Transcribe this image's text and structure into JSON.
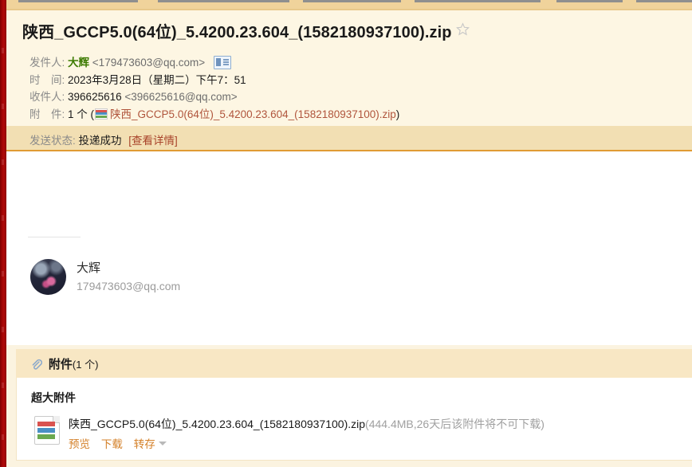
{
  "window": {
    "accent_rail_color": "#a30505",
    "header_bg": "#fdf6e3",
    "status_bg": "#f2dfb3",
    "attachment_bg": "#f8e7c4"
  },
  "tabstrip": {
    "segments": 6
  },
  "header": {
    "subject": "陕西_GCCP5.0(64位)_5.4200.23.604_(1582180937100).zip",
    "star_icon": "star-outline-icon",
    "fields": {
      "from_label": "发件人:",
      "from_name": "大辉",
      "from_email": "<179473603@qq.com>",
      "contact_icon": "contact-card-icon",
      "time_label": "时　间:",
      "time_value": "2023年3月28日（星期二）下午7：51",
      "to_label": "收件人:",
      "to_name": "396625616",
      "to_email": "<396625616@qq.com>",
      "attach_label": "附　件:",
      "attach_count": "1 个 (",
      "attach_icon": "zip-file-icon",
      "attach_name": "陕西_GCCP5.0(64位)_5.4200.23.604_(1582180937100).zip",
      "attach_close": ")"
    }
  },
  "status": {
    "label": "发送状态:",
    "value": "投递成功",
    "link": "[查看详情]"
  },
  "body": {
    "signature": {
      "avatar": "user-avatar",
      "name": "大辉",
      "email": "179473603@qq.com"
    }
  },
  "attachments": {
    "panel_title": "附件",
    "panel_count": "(1 个)",
    "clip_icon": "paperclip-icon",
    "group_title": "超大附件",
    "items": [
      {
        "icon": "zip-file-icon",
        "name": "陕西_GCCP5.0(64位)_5.4200.23.604_(1582180937100).zip",
        "meta": "(444.4MB,26天后该附件将不可下载)",
        "actions": [
          "预览",
          "下载",
          "转存"
        ],
        "dropdown_icon": "caret-down-icon"
      }
    ]
  }
}
